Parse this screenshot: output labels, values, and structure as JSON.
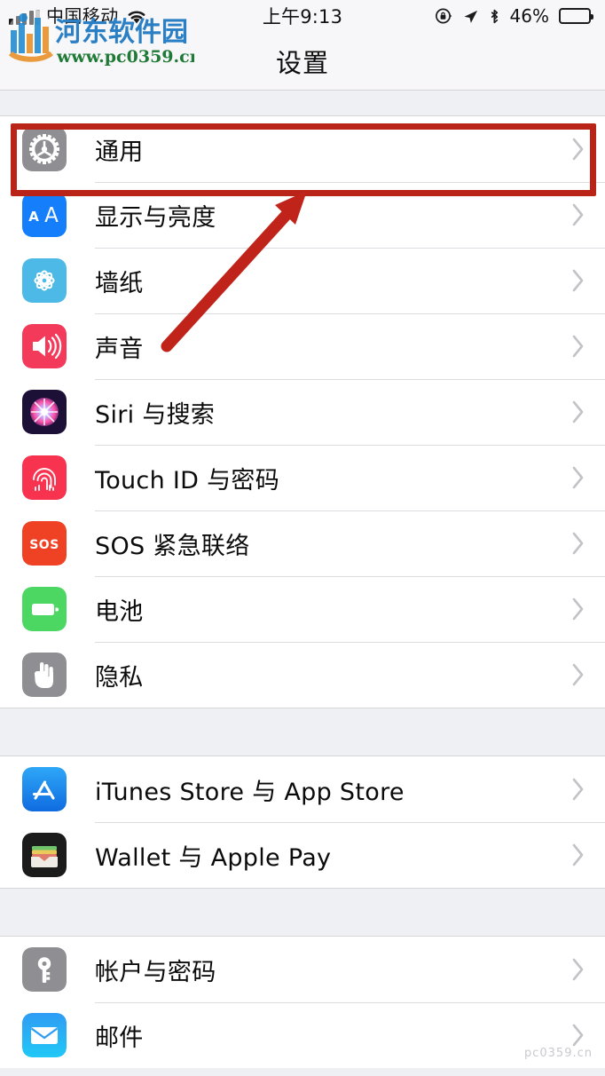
{
  "status_bar": {
    "carrier": "中国移动",
    "wifi_icon": "wifi-icon",
    "signal_icon": "signal-bars-icon",
    "time": "上午9:13",
    "rotation_lock_icon": "rotation-lock-icon",
    "location_icon": "location-arrow-icon",
    "bluetooth_icon": "bluetooth-icon",
    "battery_percent": "46%",
    "battery_level": 46
  },
  "navbar": {
    "title": "设置"
  },
  "sections": [
    {
      "id": "system",
      "rows": [
        {
          "label": "通用",
          "icon": "gear-icon",
          "icon_color": "#8e8e93",
          "highlighted": true
        },
        {
          "label": "显示与亮度",
          "icon": "text-size-icon",
          "icon_color": "#147efb"
        },
        {
          "label": "墙纸",
          "icon": "wallpaper-icon",
          "icon_color": "#4cb9e6"
        },
        {
          "label": "声音",
          "icon": "speaker-icon",
          "icon_color": "#f43a5b"
        },
        {
          "label": "Siri 与搜索",
          "icon": "siri-icon",
          "icon_color": "#1c1036"
        },
        {
          "label": "Touch ID 与密码",
          "icon": "fingerprint-icon",
          "icon_color": "#f8334f"
        },
        {
          "label": "SOS 紧急联络",
          "icon": "sos-icon",
          "icon_color": "#ef4123"
        },
        {
          "label": "电池",
          "icon": "battery-icon",
          "icon_color": "#4cd763"
        },
        {
          "label": "隐私",
          "icon": "hand-icon",
          "icon_color": "#8e8e93"
        }
      ]
    },
    {
      "id": "stores",
      "rows": [
        {
          "label": "iTunes Store 与 App Store",
          "icon": "app-store-icon",
          "icon_color": "#1d9bf7"
        },
        {
          "label": "Wallet 与 Apple Pay",
          "icon": "wallet-icon",
          "icon_color": "#1b1b1b"
        }
      ]
    },
    {
      "id": "accounts",
      "rows": [
        {
          "label": "帐户与密码",
          "icon": "key-icon",
          "icon_color": "#8e8e93"
        },
        {
          "label": "邮件",
          "icon": "mail-icon",
          "icon_color": "#1d9bf7"
        }
      ]
    }
  ],
  "annotations": {
    "highlight_color": "#ba2418",
    "highlight_target": "通用",
    "arrow_color": "#c0231a",
    "arrow_points_to": "通用"
  },
  "watermark": {
    "site_name": "河东软件园",
    "url": "www.pc0359.cn",
    "logo_color_blue": "#2b8fd4",
    "logo_color_orange": "#e8942f",
    "text_color": "#2b7fc4",
    "url_color": "#1f7a36"
  },
  "chevron_icon": "chevron-right-icon"
}
